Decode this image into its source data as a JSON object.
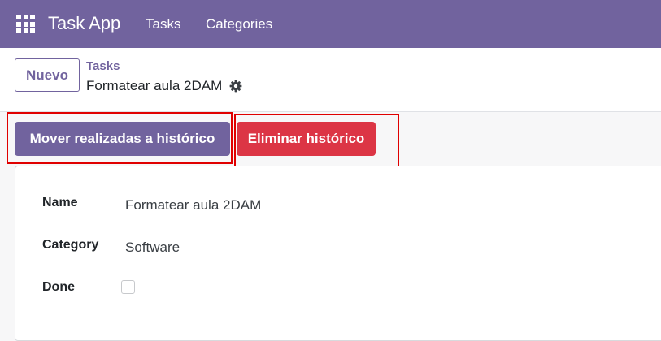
{
  "navbar": {
    "apps_icon": "grid-icon",
    "brand": "Task App",
    "menu": [
      {
        "label": "Tasks"
      },
      {
        "label": "Categories"
      }
    ]
  },
  "control_panel": {
    "new_button": "Nuevo",
    "breadcrumb_parent": "Tasks",
    "breadcrumb_current": "Formatear aula 2DAM",
    "settings_icon": "gear-icon"
  },
  "statusbar": {
    "move_button": "Mover realizadas a histórico",
    "delete_button": "Eliminar histórico"
  },
  "form": {
    "fields": [
      {
        "label": "Name",
        "value": "Formatear aula 2DAM"
      },
      {
        "label": "Category",
        "value": "Software"
      },
      {
        "label": "Done",
        "checked": false
      }
    ]
  },
  "colors": {
    "brand": "#71639e",
    "danger": "#dc3545",
    "highlight": "#e00000"
  }
}
